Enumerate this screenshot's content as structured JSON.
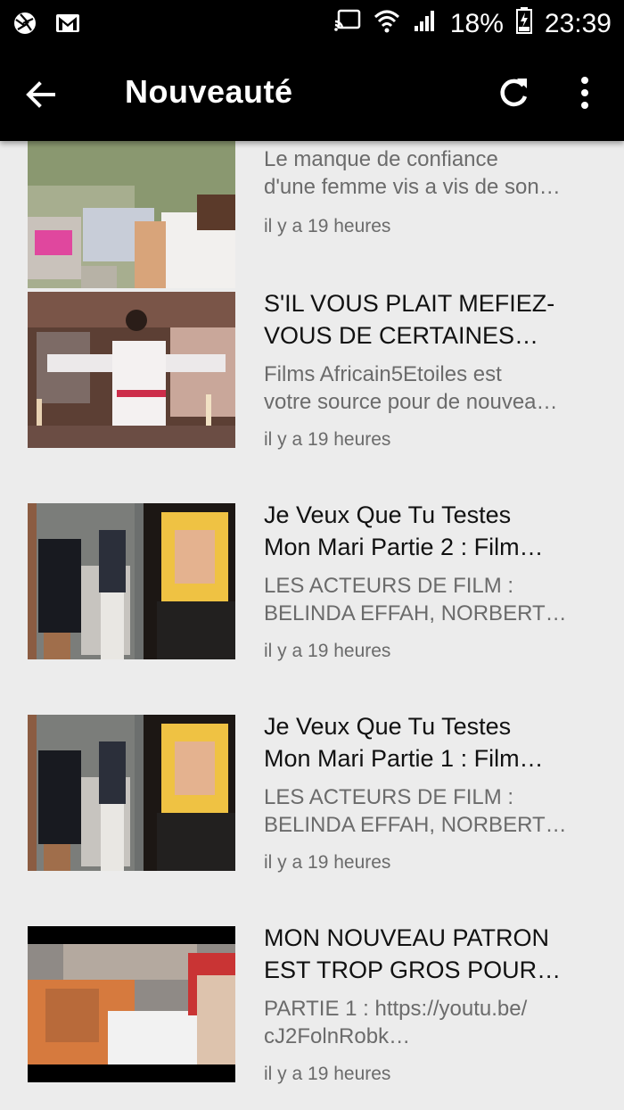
{
  "status_bar": {
    "battery": "18%",
    "time": "23:39",
    "icons": [
      "aperture-icon",
      "gmail-icon",
      "cast-icon",
      "wifi-icon",
      "signal-icon",
      "battery-charging-icon"
    ]
  },
  "app_bar": {
    "title": "Nouveauté",
    "icons": [
      "back-arrow-icon",
      "refresh-icon",
      "more-vert-icon"
    ]
  },
  "videos": [
    {
      "title_lines": [],
      "desc_lines": [
        "Le manque de confiance",
        "d'une femme vis a vis de son…"
      ],
      "time": "il y a 19 heures"
    },
    {
      "title_lines": [
        "S'IL VOUS PLAIT MEFIEZ-",
        "VOUS DE CERTAINES…"
      ],
      "desc_lines": [
        "Films Africain5Etoiles  est",
        "votre source pour de nouvea…"
      ],
      "time": "il y a 19 heures"
    },
    {
      "title_lines": [
        "Je Veux Que Tu Testes",
        "Mon Mari Partie 2 :  Film…"
      ],
      "desc_lines": [
        "LES ACTEURS DE FILM :",
        "BELINDA EFFAH, NORBERT…"
      ],
      "time": "il y a 19 heures"
    },
    {
      "title_lines": [
        "Je Veux Que Tu Testes",
        "Mon Mari Partie 1 :  Film…"
      ],
      "desc_lines": [
        "LES ACTEURS DE FILM :",
        "BELINDA EFFAH, NORBERT…"
      ],
      "time": "il y a 19 heures"
    },
    {
      "title_lines": [
        "MON NOUVEAU PATRON",
        "EST TROP GROS POUR…"
      ],
      "desc_lines": [
        "PARTIE 1 :  https://youtu.be/",
        "cJ2FolnRobk…"
      ],
      "time": "il y a 19 heures"
    }
  ],
  "colors": {
    "bar": "#000000",
    "background": "#ececec",
    "title_text": "#111111",
    "secondary_text": "#6b6b6b"
  }
}
